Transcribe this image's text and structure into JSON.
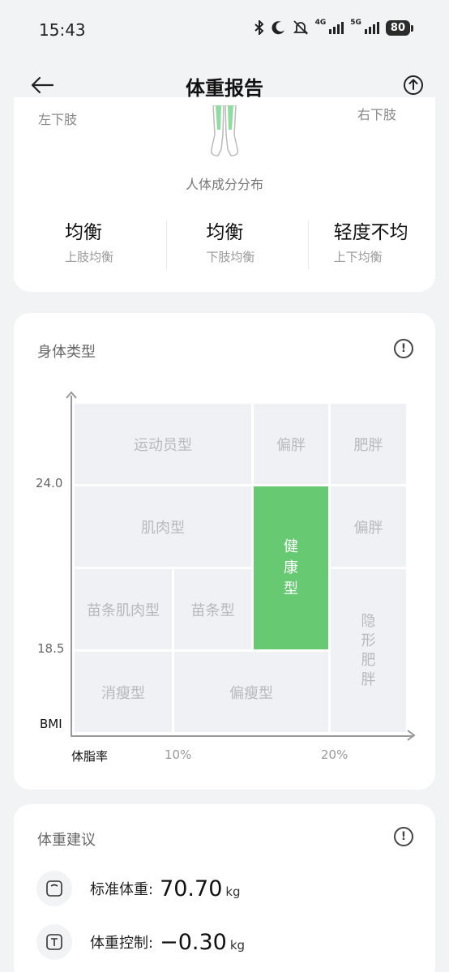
{
  "status_bar": {
    "time": "15:43",
    "network_1": "4G",
    "network_2": "5G",
    "battery": "80"
  },
  "header": {
    "title": "体重报告"
  },
  "body_composition": {
    "left_lower_limb": "左下肢",
    "right_lower_limb": "右下肢",
    "caption": "人体成分分布",
    "balance": [
      {
        "value": "均衡",
        "label": "上肢均衡"
      },
      {
        "value": "均衡",
        "label": "下肢均衡"
      },
      {
        "value": "轻度不均",
        "label": "上下均衡"
      }
    ]
  },
  "body_type": {
    "title": "身体类型",
    "y_ticks": [
      "24.0",
      "18.5"
    ],
    "y_axis_label": "BMI",
    "x_axis_label": "体脂率",
    "x_ticks": [
      "10%",
      "20%"
    ],
    "cells": {
      "athlete": "运动员型",
      "slightly_fat_top": "偏胖",
      "obese": "肥胖",
      "muscular": "肌肉型",
      "healthy": "健康型",
      "slightly_fat_mid": "偏胖",
      "slim_muscular": "苗条肌肉型",
      "slim": "苗条型",
      "hidden_obese": "隐形肥胖",
      "thin": "消瘦型",
      "slightly_thin": "偏瘦型"
    },
    "current_type": "健康型",
    "highlight_color": "#67c972"
  },
  "weight_advice": {
    "title": "体重建议",
    "standard_weight_label": "标准体重:",
    "standard_weight_value": "70.70",
    "standard_weight_unit": "kg",
    "weight_control_label": "体重控制:",
    "weight_control_value": "−0.30",
    "weight_control_unit": "kg"
  }
}
